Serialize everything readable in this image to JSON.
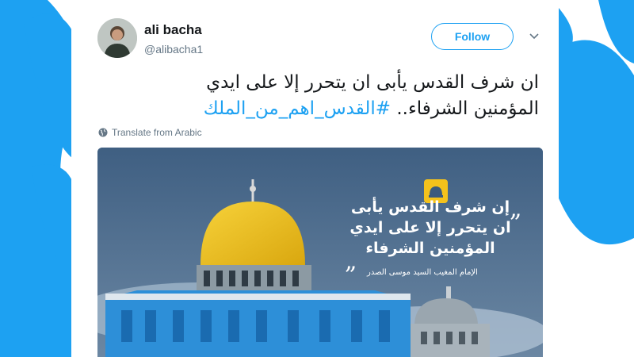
{
  "tweet": {
    "display_name": "ali bacha",
    "handle": "@alibacha1",
    "follow_label": "Follow",
    "text_line1": "ان شرف القدس يأبى ان يتحرر إلا على ايدي",
    "text_line2_prefix": "المؤمنين الشرفاء.. ",
    "hashtag": "#القدس_اهم_من_الملك",
    "translate_label": "Translate from Arabic"
  },
  "media": {
    "quote_line1": "إن شرف القدس يأبى",
    "quote_line2": "ان يتحرر إلا على ايدي",
    "quote_line3": "المؤمنين الشرفاء",
    "attribution": "الإمام المغيب السيد موسى الصدر"
  },
  "colors": {
    "accent": "#1da1f2",
    "dome_gold": "#f2c21a",
    "image_background": "#3b5a7d"
  },
  "icons": {
    "chevron": "chevron-down-icon",
    "globe": "globe-icon",
    "logo": "dome-logo-icon"
  }
}
